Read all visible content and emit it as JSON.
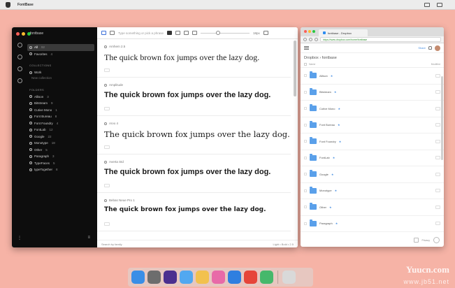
{
  "menubar": {
    "app_name": "FontBase",
    "clock": ""
  },
  "font_app": {
    "user": "fontbase",
    "sidebar": {
      "top_items": [
        {
          "label": "All",
          "count": "92",
          "selected": true
        },
        {
          "label": "Favorites",
          "count": "4",
          "selected": false
        }
      ],
      "collections_heading": "COLLECTIONS",
      "collections": [
        {
          "label": "Work",
          "count": ""
        }
      ],
      "new_collection": "New collection",
      "folders_heading": "FOLDERS",
      "folders": [
        {
          "label": "Allison",
          "count": "3"
        },
        {
          "label": "Bitstream",
          "count": "9"
        },
        {
          "label": "Cutive Mono",
          "count": "1"
        },
        {
          "label": "Font Bureau",
          "count": "8"
        },
        {
          "label": "Font Foundry",
          "count": "4"
        },
        {
          "label": "FontLab",
          "count": "12"
        },
        {
          "label": "Google",
          "count": "22"
        },
        {
          "label": "Monotype",
          "count": "18"
        },
        {
          "label": "Other",
          "count": "5"
        },
        {
          "label": "Paragraph",
          "count": "3"
        },
        {
          "label": "TypeFaces",
          "count": "5"
        },
        {
          "label": "typeTogether",
          "count": "8"
        }
      ]
    },
    "toolbar": {
      "placeholder": "Type something or pick a phrase",
      "size": "18px"
    },
    "samples": [
      {
        "name": "Arnhem 2.5",
        "text": "The quick brown fox jumps over the lazy dog.",
        "font": "\"Liberation Serif\", serif",
        "weight": "normal",
        "size": "12px"
      },
      {
        "name": "Amplitude",
        "text": "The quick brown fox jumps over the lazy dog.",
        "font": "\"Liberation Sans\", sans-serif",
        "weight": "bold",
        "size": "11px"
      },
      {
        "name": "Arvo 4",
        "text": "The quick brown fox jumps over the lazy dog.",
        "font": "\"DejaVu Serif\", serif",
        "weight": "normal",
        "size": "11.5px"
      },
      {
        "name": "Averta Std",
        "text": "The quick brown fox jumps over the lazy dog.",
        "font": "\"Liberation Sans\", sans-serif",
        "weight": "bold",
        "size": "11px"
      },
      {
        "name": "Bebas Neue Pro 1",
        "text": "The quick brown fox jumps over the lazy dog.",
        "font": "\"DejaVu Sans\", sans-serif",
        "weight": "bold",
        "size": "9px"
      }
    ],
    "status": {
      "left": "Search by family",
      "right": "Light • Bold • 2.5"
    }
  },
  "browser": {
    "tab_title": "fontbase - Dropbox",
    "url": "https://www.dropbox.com/home/fontbase",
    "app_share": "Share",
    "breadcrumb": "Dropbox › fontbase",
    "col_name": "Name",
    "col_right": "Modified",
    "folders": [
      {
        "name": "Allison",
        "shared": true
      },
      {
        "name": "Bitstream",
        "shared": true
      },
      {
        "name": "Cutive Mono",
        "shared": true
      },
      {
        "name": "Font Bureau",
        "shared": true
      },
      {
        "name": "Font Foundry",
        "shared": true
      },
      {
        "name": "FontLab",
        "shared": true
      },
      {
        "name": "Google",
        "shared": true
      },
      {
        "name": "Monotype",
        "shared": true
      },
      {
        "name": "Other",
        "shared": true
      },
      {
        "name": "Paragraph",
        "shared": true
      }
    ],
    "footer_text": "Privacy"
  },
  "dock": {
    "icons": [
      {
        "name": "finder",
        "color": "#3a8ee6"
      },
      {
        "name": "launchpad",
        "color": "#6d6d6d"
      },
      {
        "name": "affinity",
        "color": "#4b2f8f"
      },
      {
        "name": "messages",
        "color": "#52a8f0"
      },
      {
        "name": "photos",
        "color": "#f2c14e"
      },
      {
        "name": "itunes",
        "color": "#e86aa8"
      },
      {
        "name": "dropbox",
        "color": "#2f7fe0"
      },
      {
        "name": "chrome",
        "color": "#e6453a"
      },
      {
        "name": "fontbase",
        "color": "#46b86b"
      },
      {
        "name": "trash",
        "color": "#d9d9d9"
      }
    ]
  },
  "watermark": {
    "line1": "Yuucn.com",
    "line2": "www.jb51.net"
  }
}
